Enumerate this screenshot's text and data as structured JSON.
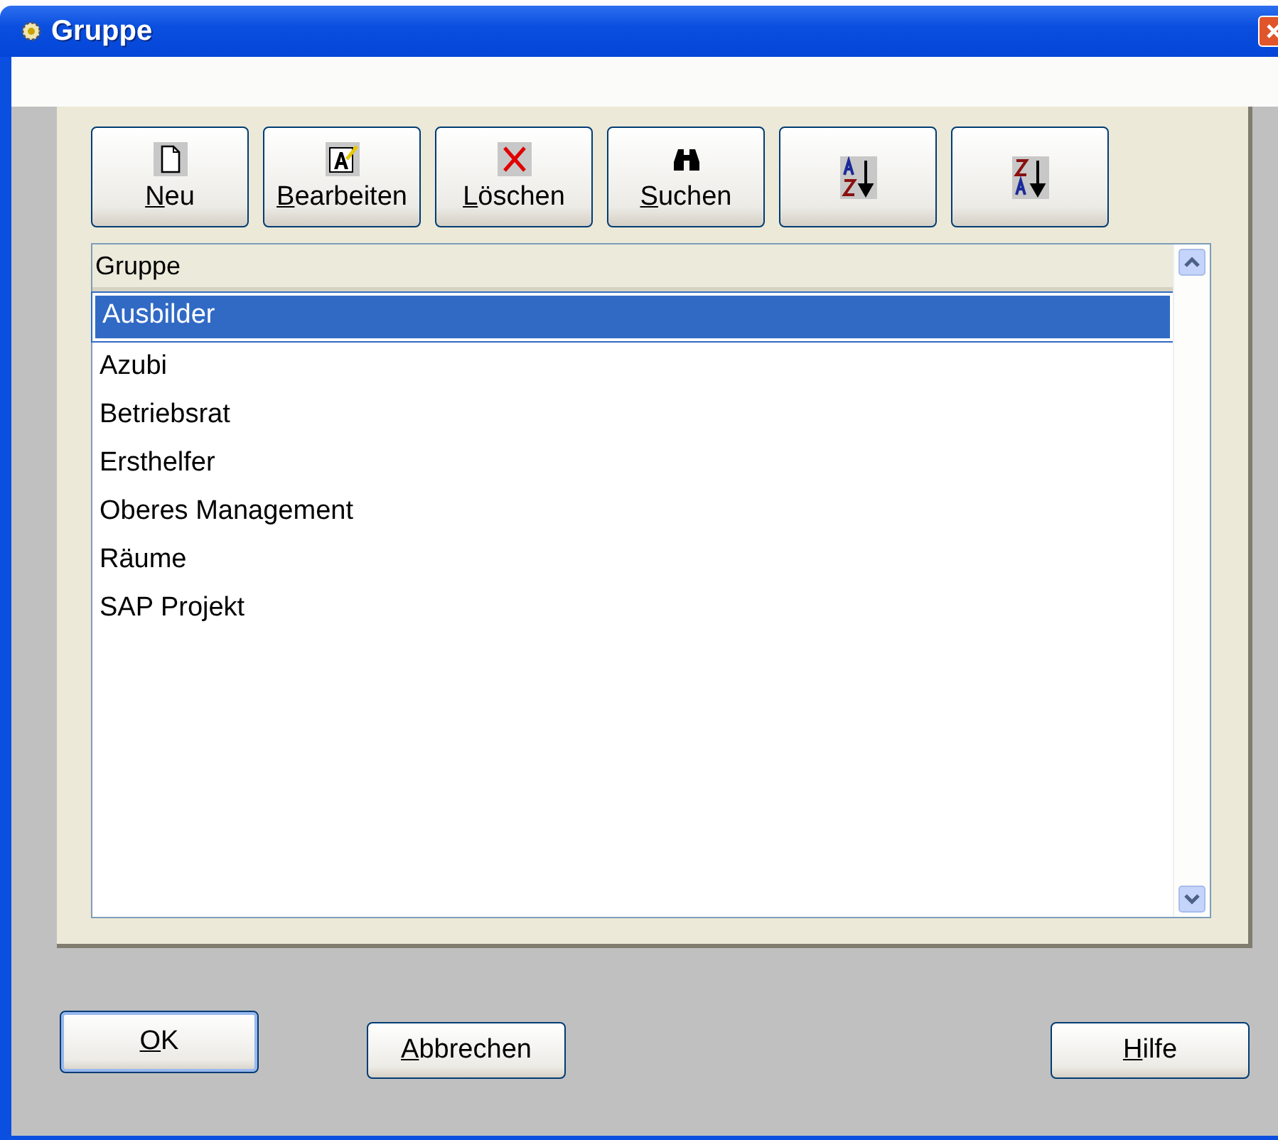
{
  "window": {
    "title": "Gruppe"
  },
  "toolbar": [
    {
      "kind": "new",
      "label": "Neu"
    },
    {
      "kind": "edit",
      "label": "Bearbeiten"
    },
    {
      "kind": "delete",
      "label": "Löschen"
    },
    {
      "kind": "search",
      "label": "Suchen"
    },
    {
      "kind": "sort_asc"
    },
    {
      "kind": "sort_desc"
    }
  ],
  "list": {
    "column": "Gruppe",
    "rows": [
      {
        "text": "Ausbilder",
        "selected": true
      },
      {
        "text": "Azubi",
        "selected": false
      },
      {
        "text": "Betriebsrat",
        "selected": false
      },
      {
        "text": "Ersthelfer",
        "selected": false
      },
      {
        "text": "Oberes Management",
        "selected": false
      },
      {
        "text": "Räume",
        "selected": false
      },
      {
        "text": "SAP Projekt",
        "selected": false
      }
    ]
  },
  "buttons": [
    {
      "label": "OK",
      "default": true
    },
    {
      "label": "Abbrechen",
      "default": false
    },
    {
      "label": "Hilfe",
      "default": false
    }
  ]
}
